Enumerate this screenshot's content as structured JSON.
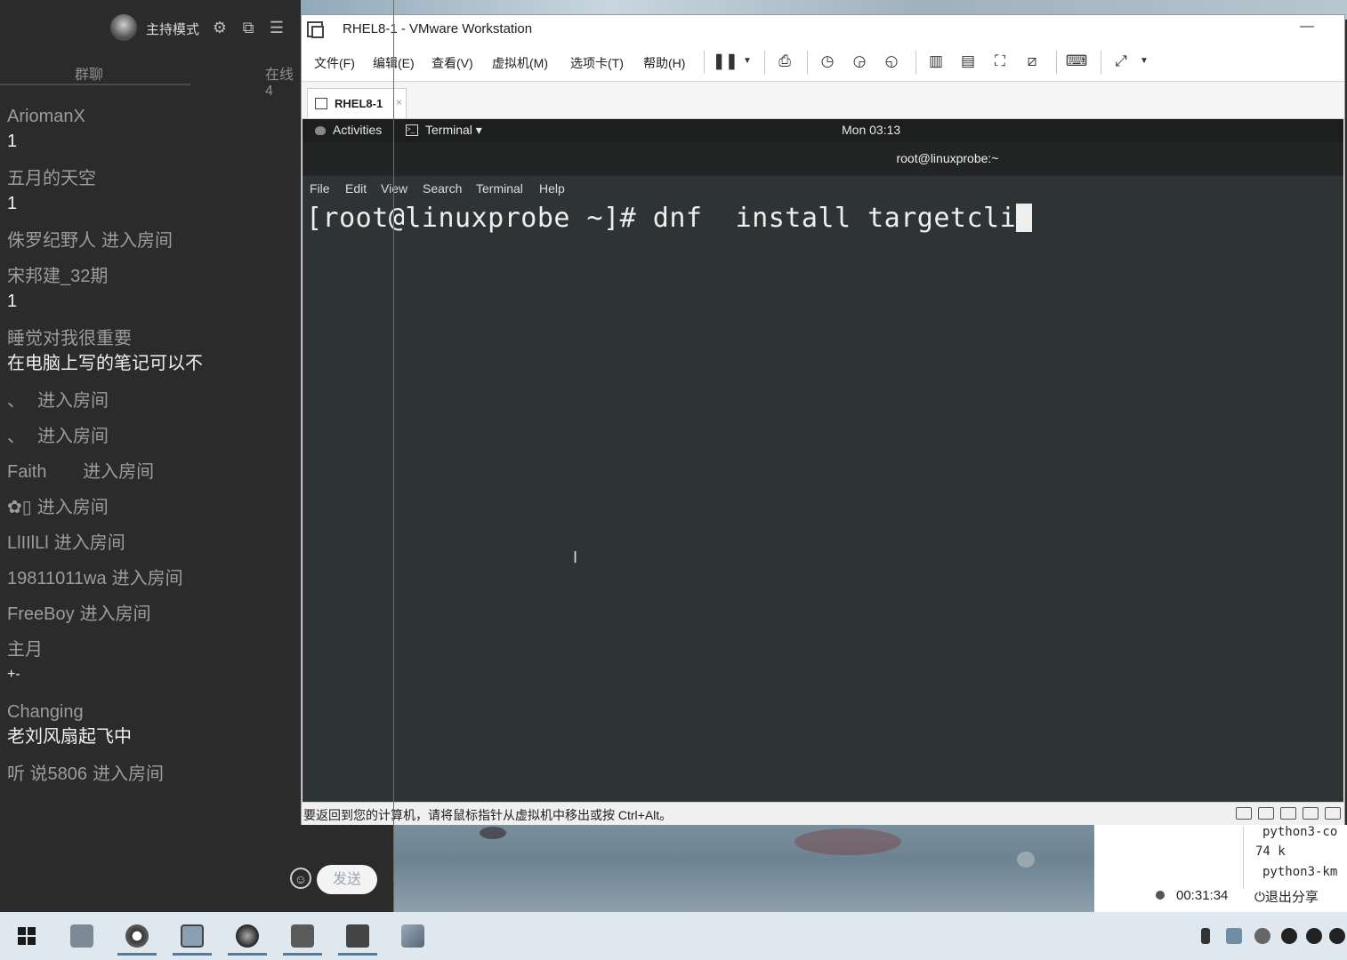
{
  "chat": {
    "host_mode": "主持模式",
    "tabs": [
      "群聊",
      "在线4"
    ],
    "messages": [
      {
        "name": "AriomanX",
        "text": "1"
      },
      {
        "name": "五月的天空",
        "text": "1"
      },
      {
        "name": "侏罗纪野人",
        "join": "进入房间"
      },
      {
        "name": "宋邦建_32期",
        "text": "1"
      },
      {
        "name": "睡觉对我很重要",
        "text": "在电脑上写的笔记可以不"
      },
      {
        "name": "、",
        "join": "进入房间"
      },
      {
        "name": "、",
        "join": "进入房间"
      },
      {
        "name": "Faith   ",
        "join": "进入房间"
      },
      {
        "name": "✿▯",
        "join": "进入房间"
      },
      {
        "name": "LlIIlLl",
        "join": "进入房间"
      },
      {
        "name": "19811011wa",
        "join": "进入房间"
      },
      {
        "name": "FreeBoy",
        "join": "进入房间"
      },
      {
        "name": "主月",
        "text": "+-"
      },
      {
        "name": "Changing",
        "text": "老刘风扇起飞中"
      },
      {
        "name": "听 说5806",
        "join": "进入房间"
      }
    ],
    "send_label": "发送"
  },
  "vmware": {
    "title": "RHEL8-1 - VMware Workstation",
    "menu": [
      "文件(F)",
      "编辑(E)",
      "查看(V)",
      "虚拟机(M)",
      "选项卡(T)",
      "帮助(H)"
    ],
    "vm_tab": "RHEL8-1",
    "status_text": "要返回到您的计算机，请将鼠标指针从虚拟机中移出或按 Ctrl+Alt。"
  },
  "guest": {
    "activities": "Activities",
    "terminal_menu": "Terminal ▾",
    "clock": "Mon 03:13",
    "terminal_title": "root@linuxprobe:~",
    "terminal_menus": [
      "File",
      "Edit",
      "View",
      "Search",
      "Terminal",
      "Help"
    ],
    "prompt": "[root@linuxprobe ~]# dnf  install targetcli"
  },
  "share": {
    "lines": [
      "python3-co",
      "74 k",
      "python3-km"
    ],
    "timer": "00:31:34",
    "exit_label": "退出分享"
  },
  "colors": {
    "terminal_bg": "#2e3436",
    "chat_bg": "#2b2b2b",
    "taskbar_bg": "#dfe7ef"
  }
}
